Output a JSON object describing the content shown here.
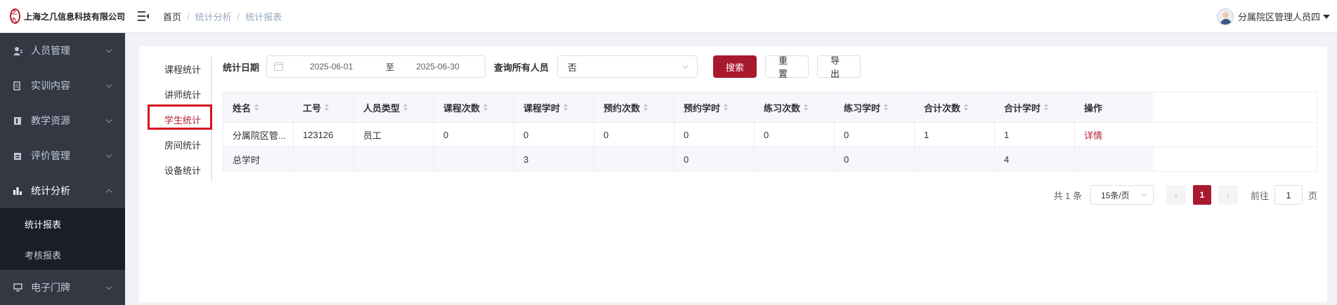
{
  "header": {
    "company": "上海之几信息科技有限公司",
    "logo_mark": "之九",
    "breadcrumb": [
      "首页",
      "统计分析",
      "统计报表"
    ],
    "user_name": "分属院区管理人员四"
  },
  "sidebar": {
    "items": [
      {
        "label": "人员管理",
        "icon": "user-icon"
      },
      {
        "label": "实训内容",
        "icon": "document-icon"
      },
      {
        "label": "教学资源",
        "icon": "book-icon"
      },
      {
        "label": "评价管理",
        "icon": "clipboard-icon"
      },
      {
        "label": "统计分析",
        "icon": "bar-chart-icon",
        "expanded": true
      },
      {
        "label": "电子门牌",
        "icon": "monitor-icon"
      }
    ],
    "submenu": [
      {
        "label": "统计报表",
        "active": true
      },
      {
        "label": "考核报表"
      }
    ]
  },
  "tabs": [
    "课程统计",
    "讲师统计",
    "学生统计",
    "房间统计",
    "设备统计"
  ],
  "active_tab": "学生统计",
  "filters": {
    "date_label": "统计日期",
    "start_date": "2025-06-01",
    "range_sep": "至",
    "end_date": "2025-06-30",
    "query_label": "查询所有人员",
    "query_value": "否",
    "search": "搜索",
    "reset": "重置",
    "export": "导出"
  },
  "table": {
    "columns": [
      "姓名",
      "工号",
      "人员类型",
      "课程次数",
      "课程学时",
      "预约次数",
      "预约学时",
      "练习次数",
      "练习学时",
      "合计次数",
      "合计学时",
      "操作"
    ],
    "rows": [
      [
        "分属院区管...",
        "123126",
        "员工",
        "0",
        "0",
        "0",
        "0",
        "0",
        "0",
        "1",
        "1",
        "详情"
      ]
    ],
    "summary": [
      "总学时",
      "",
      "",
      "",
      "3",
      "",
      "0",
      "",
      "0",
      "",
      "4",
      ""
    ]
  },
  "pagination": {
    "total": "共 1 条",
    "page_size": "15条/页",
    "current": "1",
    "goto_label": "前往",
    "goto_value": "1",
    "page_suffix": "页",
    "prev": "‹",
    "next": "›"
  },
  "colors": {
    "primary": "#a9192d",
    "sidebar_bg": "#2b2f3a",
    "highlight_box": "#d9121f"
  }
}
